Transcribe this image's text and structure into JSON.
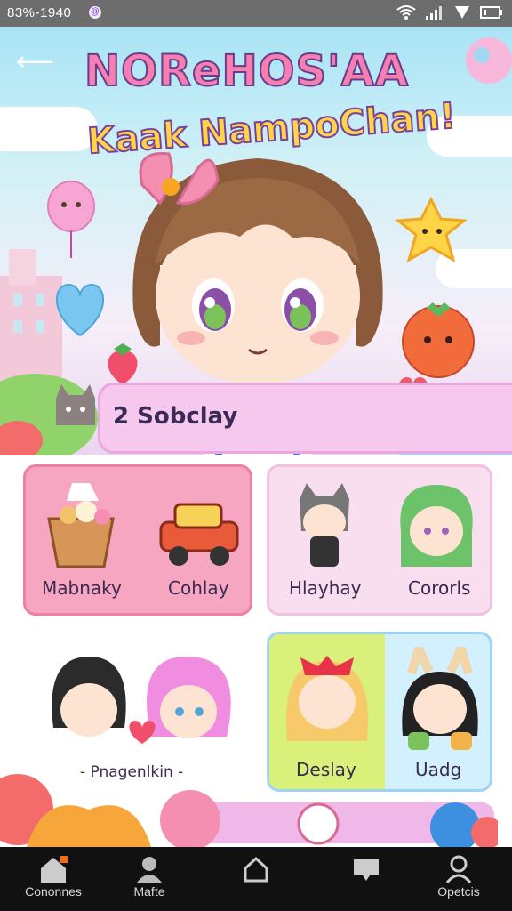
{
  "status_bar": {
    "time": "83%-1940",
    "badge": "@"
  },
  "hero": {
    "title_line1": "NOReHOS'AA",
    "title_line2": "Kaak NampoChan!",
    "banner_text": "2  Sobclay"
  },
  "cards": [
    {
      "labels": [
        "Mabnaky",
        "Cohlay"
      ]
    },
    {
      "labels": [
        "Hlayhay",
        "Cororls"
      ]
    },
    {
      "labels": [
        "- Pnagenlkin -"
      ]
    },
    {
      "labels": [
        "Deslay",
        "Uadg"
      ]
    }
  ],
  "nav": {
    "items": [
      {
        "label": "Cononnes",
        "icon": "home-icon"
      },
      {
        "label": "Mafte",
        "icon": "person-icon"
      },
      {
        "label": "",
        "icon": "house-outline-icon"
      },
      {
        "label": "",
        "icon": "chat-icon"
      },
      {
        "label": "Opetcis",
        "icon": "profile-icon"
      }
    ]
  },
  "colors": {
    "accent_pink": "#f47fb0",
    "banner": "#f6c8ee",
    "nav_bg": "#111111"
  }
}
